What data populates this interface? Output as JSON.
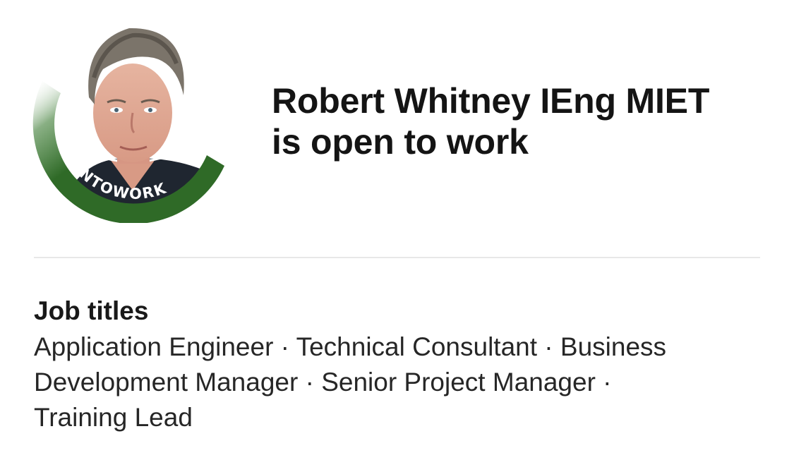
{
  "profile": {
    "name_line": "Robert Whitney IEng MIET",
    "status_line": "is open to work",
    "badge_text": "#OPENTOWORK"
  },
  "job_section": {
    "title": "Job titles",
    "titles_text": "Application Engineer · Technical Consultant · Business Development Manager · Senior Project Manager · Training Lead"
  },
  "colors": {
    "badge_green": "#3a7a31",
    "badge_dark_green": "#2f6a27",
    "text": "#000000",
    "divider": "#e8e8e8"
  }
}
